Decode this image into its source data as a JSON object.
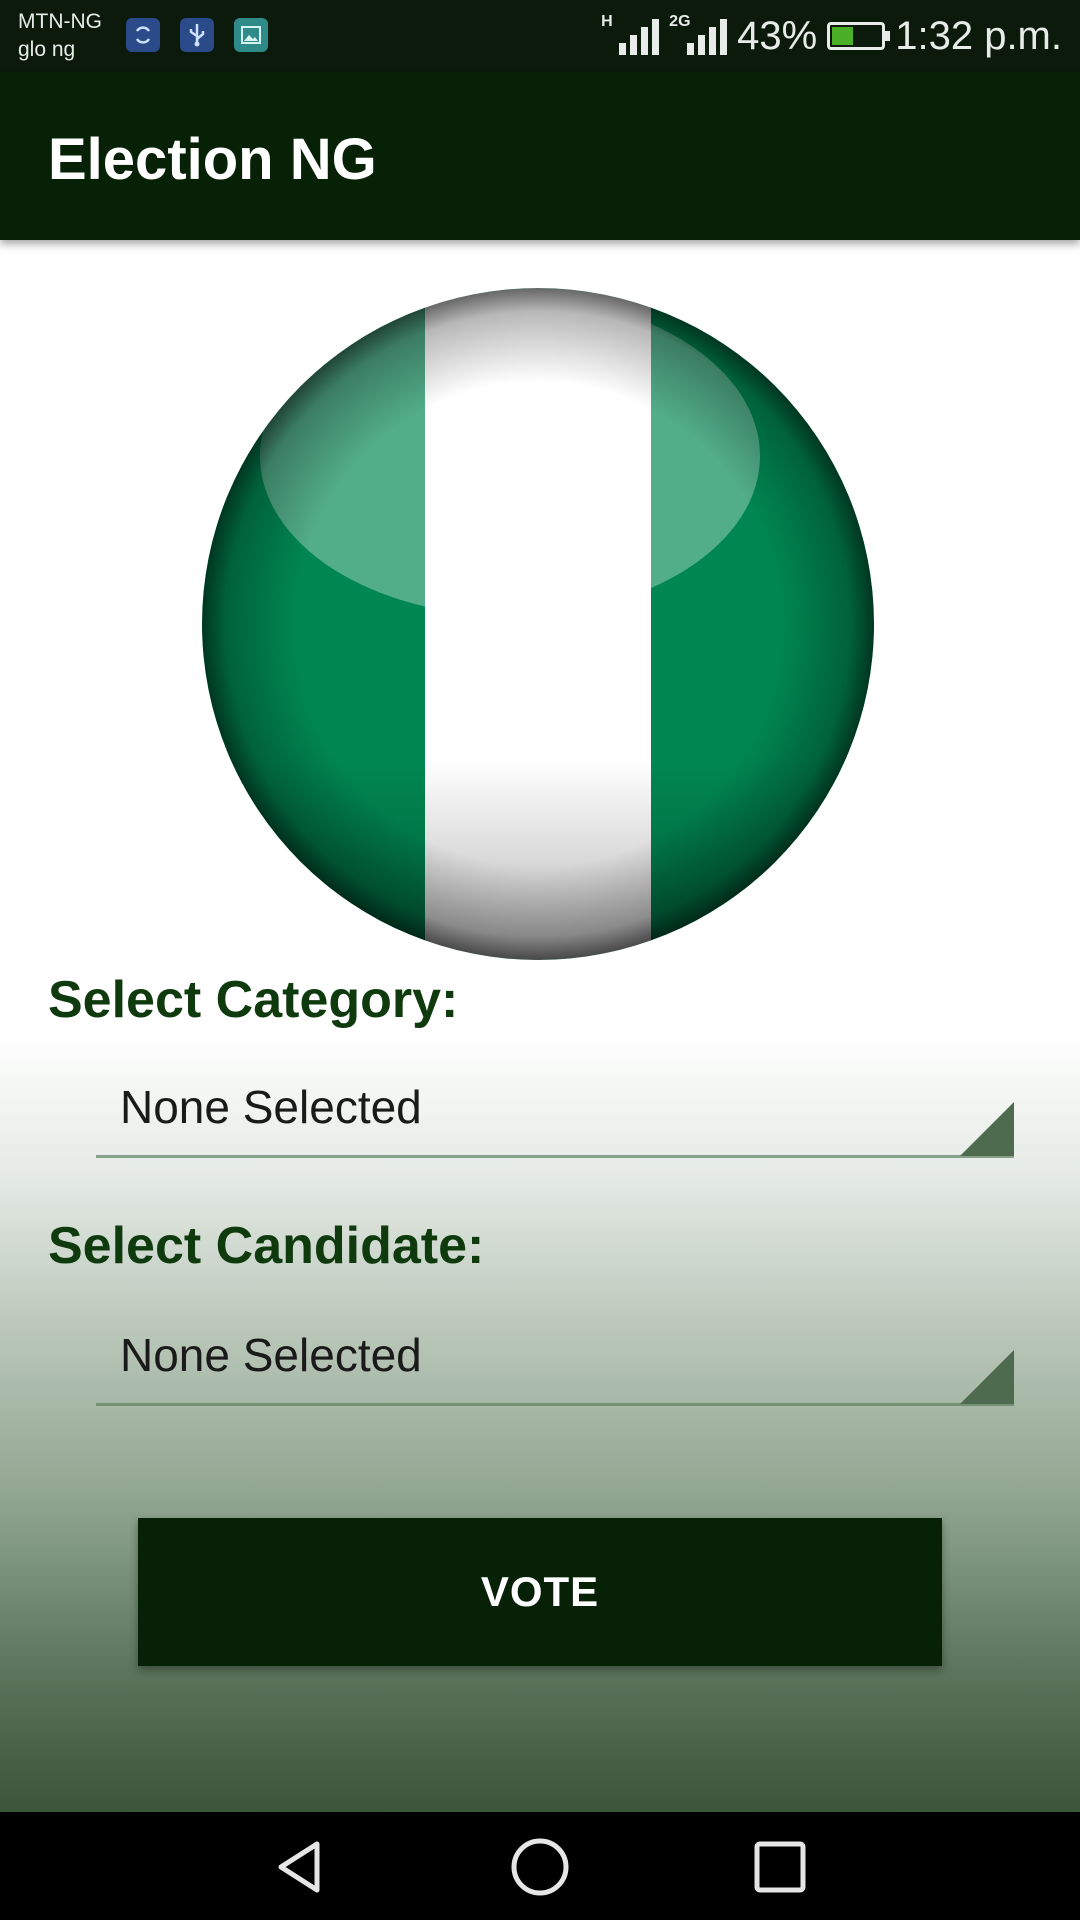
{
  "status_bar": {
    "carrier_1": "MTN-NG",
    "carrier_2": "glo ng",
    "net_type_1": "H",
    "net_type_2": "2G",
    "battery_percent": "43%",
    "battery_level": 0.43,
    "time": "1:32 p.m.",
    "notification_icons": [
      "sync-icon",
      "usb-icon",
      "gallery-icon"
    ]
  },
  "app_bar": {
    "title": "Election NG"
  },
  "flag": {
    "name": "nigeria-flag",
    "colors": {
      "green": "#008751",
      "white": "#ffffff"
    }
  },
  "form": {
    "category_label": "Select Category:",
    "category_value": "None Selected",
    "candidate_label": "Select Candidate:",
    "candidate_value": "None Selected",
    "vote_label": "VOTE"
  },
  "nav_bar": {
    "buttons": [
      "back-icon",
      "home-icon",
      "recents-icon"
    ]
  },
  "colors": {
    "primary_dark": "#062106",
    "label_green": "#0e3a0e",
    "status_bg": "#0b1a0b"
  }
}
